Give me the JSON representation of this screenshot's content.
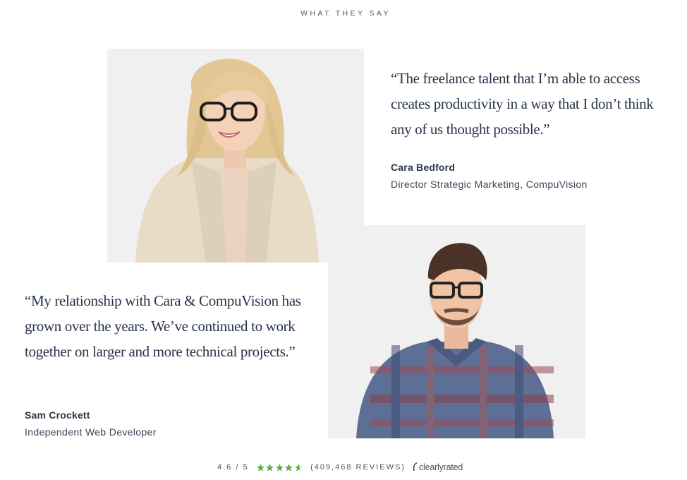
{
  "section": {
    "label": "WHAT THEY SAY"
  },
  "testimonials": [
    {
      "quote": "“The freelance talent that I’m able to access creates productivity in a way that I don’t think any of us thought possible.”",
      "name": "Cara Bedford",
      "title": "Director Strategic Marketing, CompuVision"
    },
    {
      "quote": "“My relationship with Cara & CompuVision has grown over the years. We’ve continued to work together on larger and more technical projects.”",
      "name": "Sam Crockett",
      "title": "Independent Web Developer"
    }
  ],
  "rating": {
    "score": "4.6 / 5",
    "stars": 4.6,
    "reviews": "(409,468 REVIEWS)",
    "brand": "clearlyrated",
    "star_color": "#5fb04a"
  },
  "colors": {
    "text": "#27344a",
    "photo_bg": "#f0f0f0"
  }
}
